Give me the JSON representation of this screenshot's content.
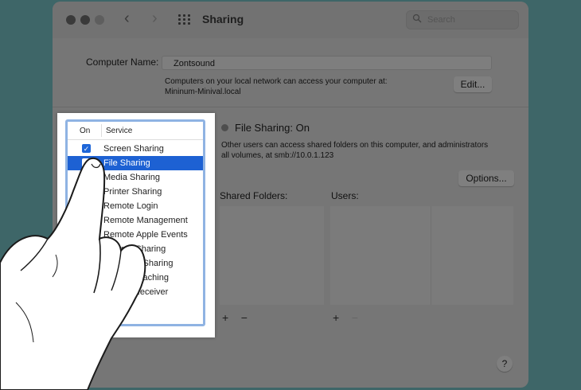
{
  "window": {
    "title": "Sharing",
    "search_placeholder": "Search",
    "nav_back_icon": "‹",
    "nav_forward_icon": "›"
  },
  "computer_name": {
    "label": "Computer Name:",
    "value": "Zontsound",
    "description_line1": "Computers on your local network can access your computer at:",
    "description_line2": "Mininum-Minival.local",
    "edit_label": "Edit..."
  },
  "service_list": {
    "header_on": "On",
    "header_service": "Service",
    "items": [
      {
        "label": "Screen Sharing",
        "checked": true,
        "selected": false
      },
      {
        "label": "File Sharing",
        "checked": true,
        "selected": true
      },
      {
        "label": "Media Sharing",
        "checked": false,
        "selected": false
      },
      {
        "label": "Printer Sharing",
        "checked": false,
        "selected": false
      },
      {
        "label": "Remote Login",
        "checked": false,
        "selected": false
      },
      {
        "label": "Remote Management",
        "checked": false,
        "selected": false
      },
      {
        "label": "Remote Apple Events",
        "checked": false,
        "selected": false
      },
      {
        "label": "Internet Sharing",
        "checked": false,
        "selected": false
      },
      {
        "label": "Bluetooth Sharing",
        "checked": false,
        "selected": false
      },
      {
        "label": "Content Caching",
        "checked": false,
        "selected": false
      },
      {
        "label": "AirPlay Receiver",
        "checked": false,
        "selected": false
      }
    ]
  },
  "detail": {
    "status": "File Sharing: On",
    "description_line1": "Other users can access shared folders on this computer, and administrators",
    "description_line2": "all volumes, at smb://10.0.1.123",
    "options_label": "Options...",
    "shared_folders_label": "Shared Folders:",
    "users_label": "Users:",
    "plus": "+",
    "minus": "−"
  },
  "help": {
    "label": "?"
  },
  "colors": {
    "background": "#3e6668",
    "dimmed_window": "#767676",
    "selection": "#1d61d3",
    "list_focus_ring": "#8fb3e3"
  }
}
